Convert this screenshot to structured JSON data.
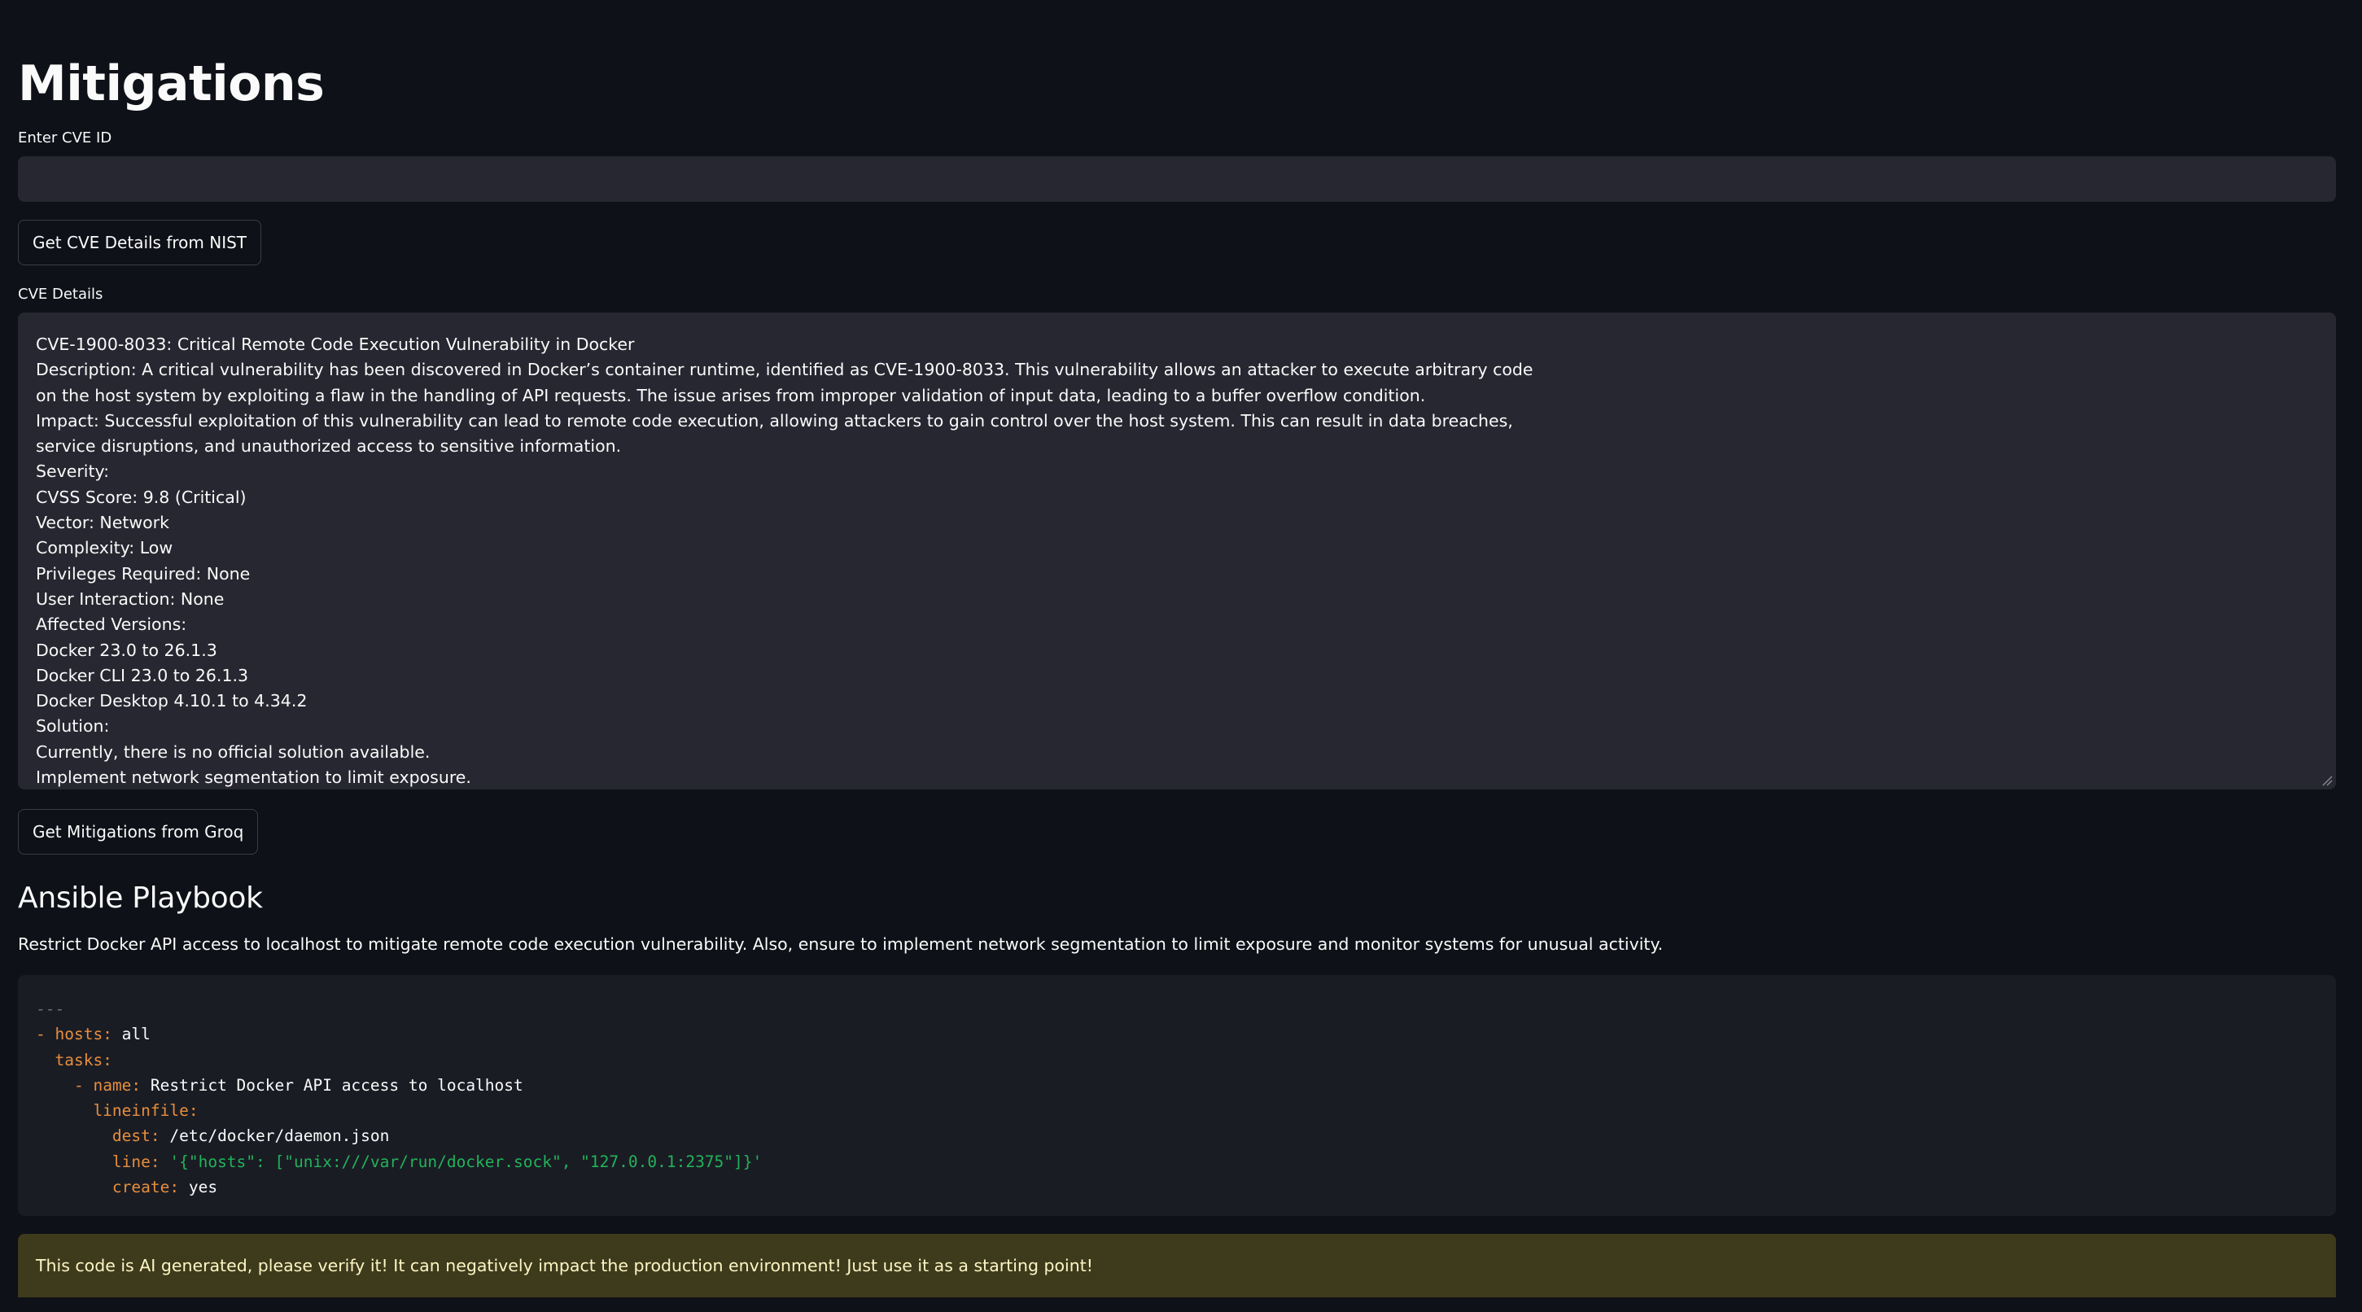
{
  "page": {
    "title": "Mitigations"
  },
  "cve_input": {
    "label": "Enter CVE ID",
    "value": ""
  },
  "buttons": {
    "nist": "Get CVE Details from NIST",
    "groq": "Get Mitigations from Groq"
  },
  "cve_details": {
    "label": "CVE Details",
    "lines": [
      "CVE-1900-8033: Critical Remote Code Execution Vulnerability in Docker",
      "Description: A critical vulnerability has been discovered in Docker’s container runtime, identified as CVE-1900-8033. This vulnerability allows an attacker to execute arbitrary code",
      "on the host system by exploiting a flaw in the handling of API requests. The issue arises from improper validation of input data, leading to a buffer overflow condition.",
      "Impact: Successful exploitation of this vulnerability can lead to remote code execution, allowing attackers to gain control over the host system. This can result in data breaches,",
      "service disruptions, and unauthorized access to sensitive information.",
      "Severity:",
      "CVSS Score: 9.8 (Critical)",
      "Vector: Network",
      "Complexity: Low",
      "Privileges Required: None",
      "User Interaction: None",
      "Affected Versions:",
      "Docker 23.0 to 26.1.3",
      "Docker CLI 23.0 to 26.1.3",
      "Docker Desktop 4.10.1 to 4.34.2",
      "Solution:",
      "Currently, there is no official solution available.",
      "Implement network segmentation to limit exposure."
    ]
  },
  "playbook": {
    "heading": "Ansible Playbook",
    "description": "Restrict Docker API access to localhost to mitigate remote code execution vulnerability. Also, ensure to implement network segmentation to limit exposure and monitor systems for unusual activity.",
    "code_lines": [
      [
        {
          "t": "---",
          "c": "comment"
        }
      ],
      [
        {
          "t": "- ",
          "c": "key"
        },
        {
          "t": "hosts:",
          "c": "key"
        },
        {
          "t": " all",
          "c": "plain"
        }
      ],
      [
        {
          "t": "  tasks:",
          "c": "key"
        }
      ],
      [
        {
          "t": "    - ",
          "c": "key"
        },
        {
          "t": "name:",
          "c": "key"
        },
        {
          "t": " Restrict Docker API access to localhost",
          "c": "plain"
        }
      ],
      [
        {
          "t": "      lineinfile:",
          "c": "key"
        }
      ],
      [
        {
          "t": "        dest:",
          "c": "key"
        },
        {
          "t": " /etc/docker/daemon.json",
          "c": "plain"
        }
      ],
      [
        {
          "t": "        line:",
          "c": "key"
        },
        {
          "t": " '{\"hosts\": [\"unix:///var/run/docker.sock\", \"127.0.0.1:2375\"]}'",
          "c": "str"
        }
      ],
      [
        {
          "t": "        create:",
          "c": "key"
        },
        {
          "t": " yes",
          "c": "plain"
        }
      ]
    ]
  },
  "warning": {
    "text": "This code is AI generated, please verify it! It can negatively impact the production environment! Just use it as a starting point!"
  },
  "colors": {
    "background": "#0e1117",
    "input_bg": "#262730",
    "code_bg": "#1a1c24",
    "yaml_key": "#e78e3c",
    "yaml_string": "#21b35a",
    "warning_bg": "#3e3a1c",
    "warning_text": "#fdf5c4"
  }
}
